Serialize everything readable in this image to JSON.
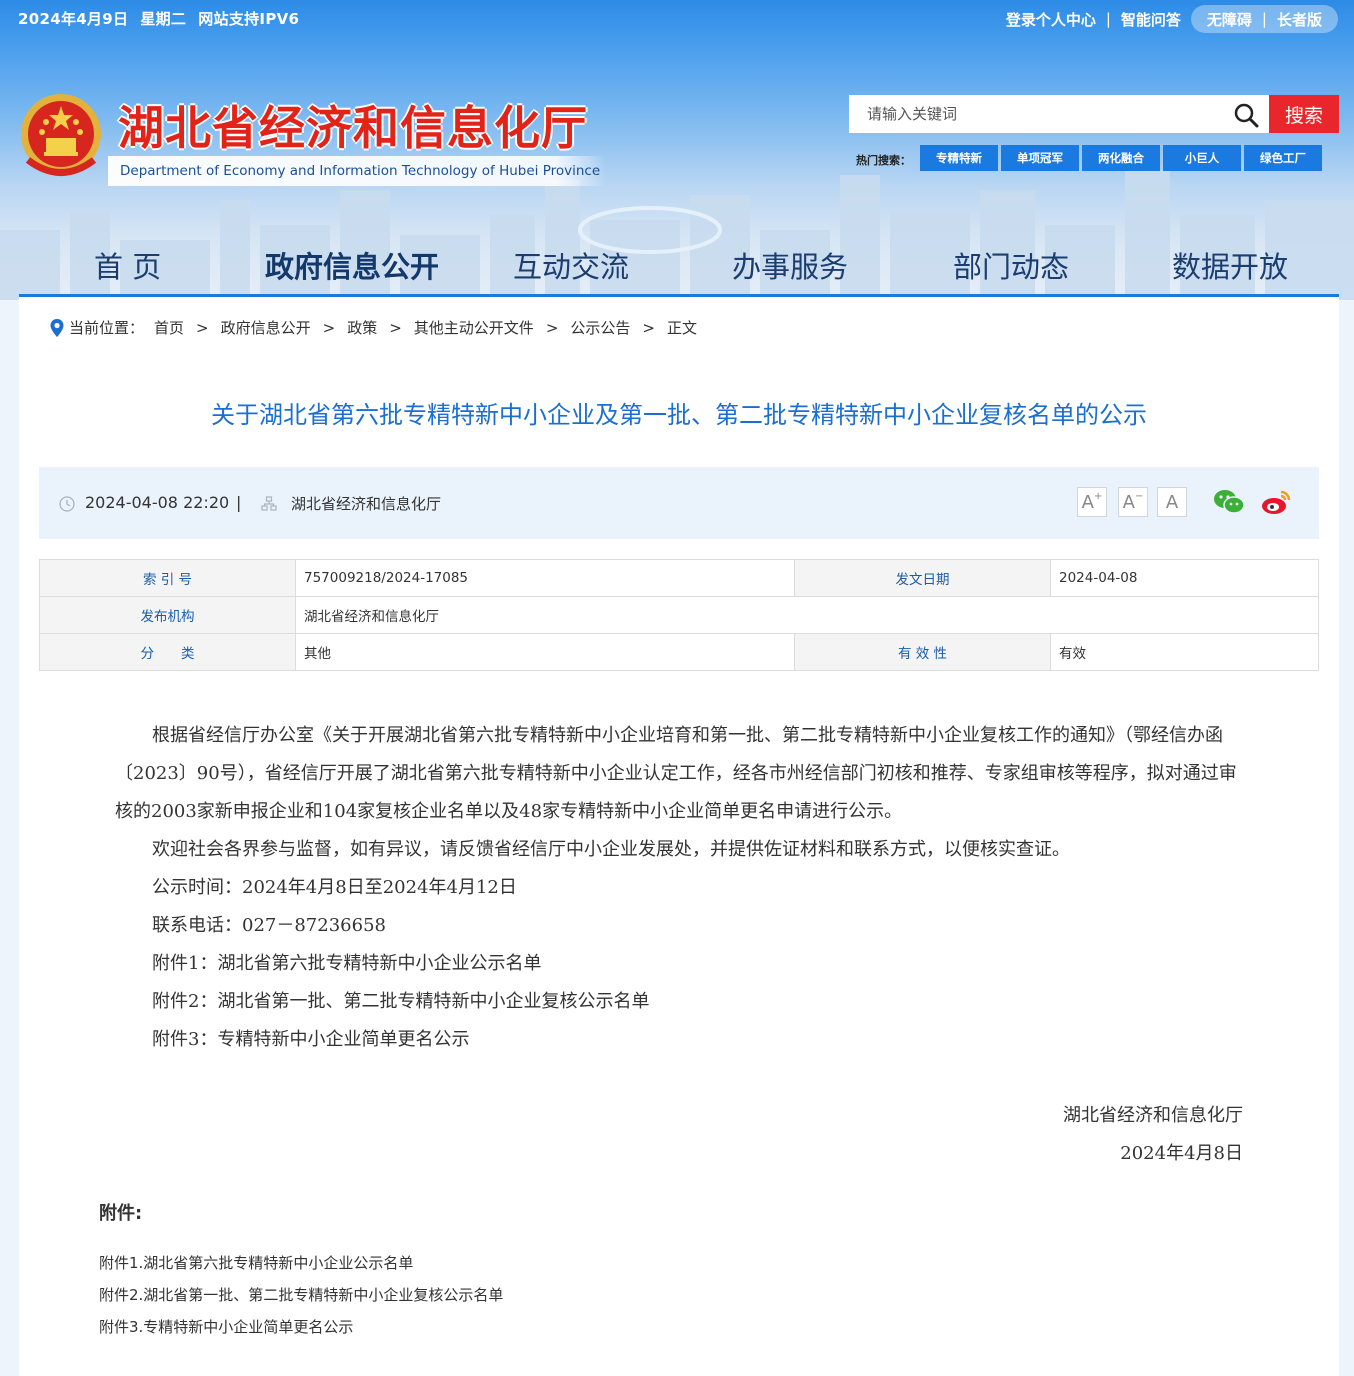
{
  "topbar": {
    "date": "2024年4月9日",
    "weekday": "星期二",
    "ipv6": "网站支持IPV6",
    "login": "登录个人中心",
    "qa": "智能问答",
    "accessible": "无障碍",
    "elder": "长者版"
  },
  "site": {
    "title": "湖北省经济和信息化厅",
    "subtitle": "Department of Economy and Information Technology of Hubei Province"
  },
  "search": {
    "placeholder": "请输入关键词",
    "button": "搜索",
    "hot_label": "热门搜索：",
    "hot_tags": [
      "专精特新",
      "单项冠军",
      "两化融合",
      "小巨人",
      "绿色工厂"
    ]
  },
  "nav": [
    "首 页",
    "政府信息公开",
    "互动交流",
    "办事服务",
    "部门动态",
    "数据开放"
  ],
  "breadcrumb": {
    "label": "当前位置：",
    "items": [
      "首页",
      "政府信息公开",
      "政策",
      "其他主动公开文件",
      "公示公告",
      "正文"
    ]
  },
  "article": {
    "title": "关于湖北省第六批专精特新中小企业及第一批、第二批专精特新中小企业复核名单的公示",
    "datetime": "2024-04-08 22:20",
    "source": "湖北省经济和信息化厅",
    "font_buttons": [
      "A",
      "A",
      "A"
    ]
  },
  "info": {
    "index_label": "索 引 号",
    "index_value": "757009218/2024-17085",
    "issue_date_label": "发文日期",
    "issue_date_value": "2024-04-08",
    "publisher_label": "发布机构",
    "publisher_value": "湖北省经济和信息化厅",
    "category_label": "分　　类",
    "category_value": "其他",
    "validity_label": "有 效 性",
    "validity_value": "有效"
  },
  "body": {
    "p1": "根据省经信厅办公室《关于开展湖北省第六批专精特新中小企业培育和第一批、第二批专精特新中小企业复核工作的通知》（鄂经信办函〔2023〕90号），省经信厅开展了湖北省第六批专精特新中小企业认定工作，经各市州经信部门初核和推荐、专家组审核等程序，拟对通过审核的2003家新申报企业和104家复核企业名单以及48家专精特新中小企业简单更名申请进行公示。",
    "p2": "欢迎社会各界参与监督，如有异议，请反馈省经信厅中小企业发展处，并提供佐证材料和联系方式，以便核实查证。",
    "p3": "公示时间：2024年4月8日至2024年4月12日",
    "p4": "联系电话：027－87236658",
    "p5": "附件1：湖北省第六批专精特新中小企业公示名单",
    "p6": "附件2：湖北省第一批、第二批专精特新中小企业复核公示名单",
    "p7": "附件3：专精特新中小企业简单更名公示",
    "sign_org": "湖北省经济和信息化厅",
    "sign_date": "2024年4月8日"
  },
  "attachments": {
    "heading": "附件:",
    "items": [
      "附件1.湖北省第六批专精特新中小企业公示名单",
      "附件2.湖北省第一批、第二批专精特新中小企业复核公示名单",
      "附件3.专精特新中小企业简单更名公示"
    ]
  }
}
